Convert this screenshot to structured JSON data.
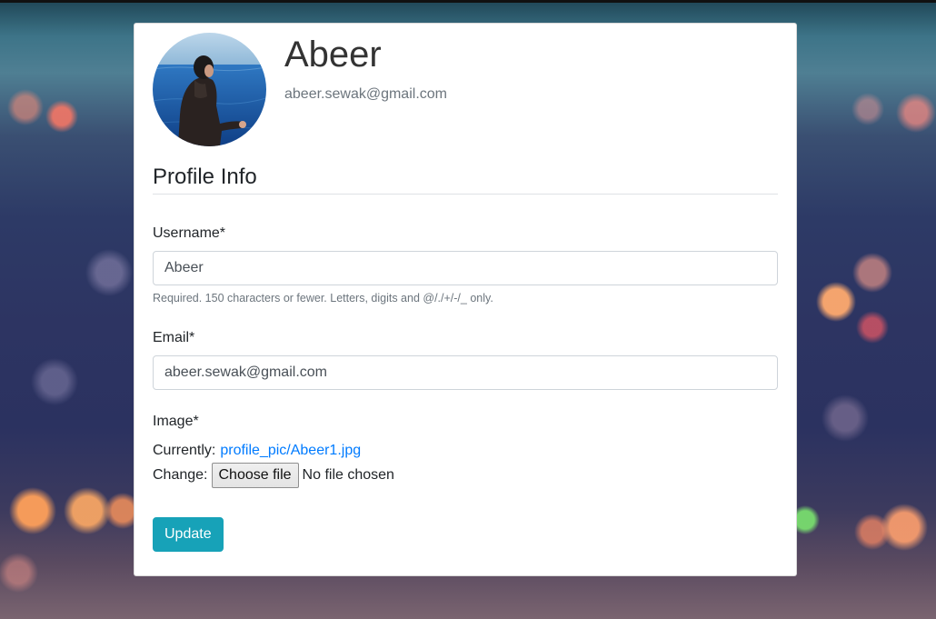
{
  "profile": {
    "name": "Abeer",
    "email": "abeer.sewak@gmail.com",
    "avatar_icon": "profile-photo"
  },
  "form": {
    "legend": "Profile Info",
    "username": {
      "label": "Username*",
      "value": "Abeer",
      "help": "Required. 150 characters or fewer. Letters, digits and @/./+/-/_ only."
    },
    "email": {
      "label": "Email*",
      "value": "abeer.sewak@gmail.com"
    },
    "image": {
      "label": "Image*",
      "currently_label": "Currently:",
      "current_file": "profile_pic/Abeer1.jpg",
      "change_label": "Change:",
      "choose_button": "Choose file",
      "no_file_text": "No file chosen"
    },
    "submit_label": "Update"
  },
  "colors": {
    "accent": "#17a2b8",
    "link": "#007bff",
    "muted": "#6c757d"
  }
}
